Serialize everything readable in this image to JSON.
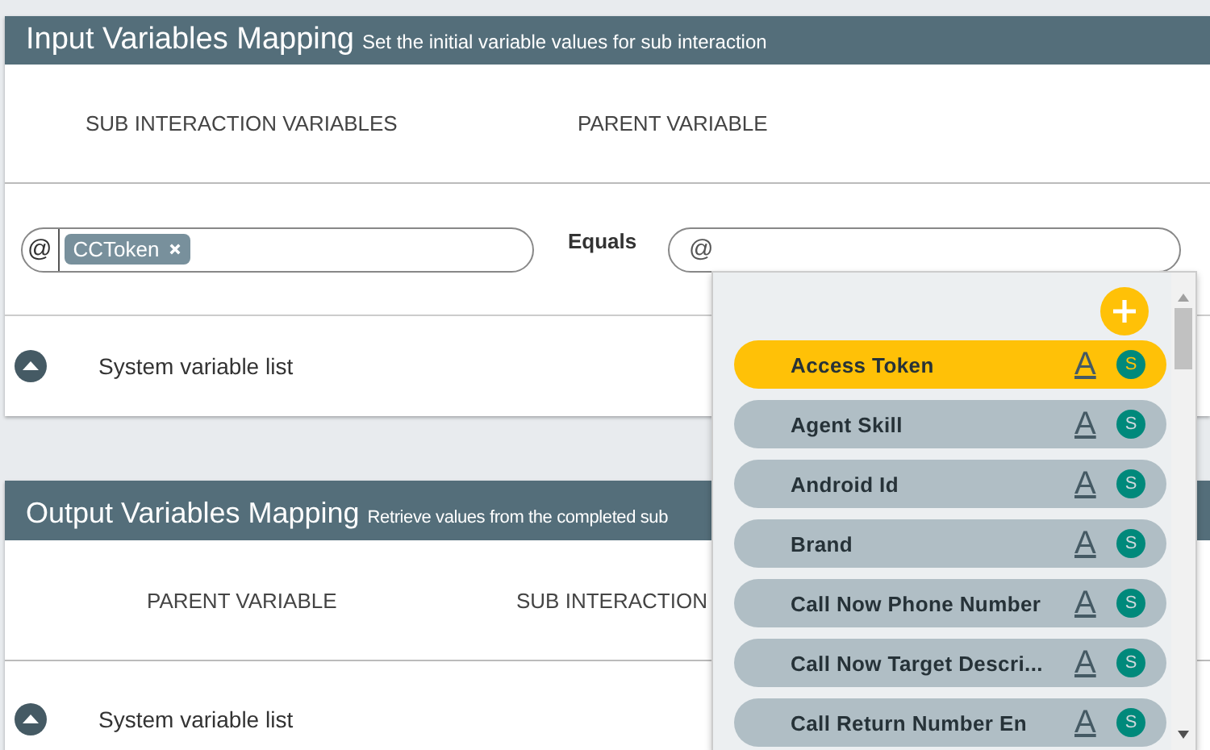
{
  "input_mapping": {
    "title": "Input Variables Mapping",
    "subtitle": "Set the initial variable values for sub interaction",
    "columns": [
      "SUB INTERACTION VARIABLES",
      "PARENT VARIABLE"
    ],
    "source_field": {
      "prefix": "@",
      "tags": [
        {
          "label": "CCToken"
        }
      ]
    },
    "operator": "Equals",
    "target_field": {
      "prefix": "@"
    },
    "system_variable_list": "System variable list"
  },
  "output_mapping": {
    "title": "Output Variables Mapping",
    "subtitle": "Retrieve values from the completed sub",
    "columns": [
      "PARENT VARIABLE",
      "SUB INTERACTION"
    ],
    "system_variable_list": "System variable list"
  },
  "dropdown": {
    "items": [
      {
        "label": "Access Token",
        "type_icon": "A",
        "badge": "S",
        "selected": true
      },
      {
        "label": "Agent Skill",
        "type_icon": "A",
        "badge": "S",
        "selected": false
      },
      {
        "label": "Android Id",
        "type_icon": "A",
        "badge": "S",
        "selected": false
      },
      {
        "label": "Brand",
        "type_icon": "A",
        "badge": "S",
        "selected": false
      },
      {
        "label": "Call Now Phone Number",
        "type_icon": "A",
        "badge": "S",
        "selected": false
      },
      {
        "label": "Call Now Target Descri...",
        "type_icon": "A",
        "badge": "S",
        "selected": false
      },
      {
        "label": "Call Return Number En",
        "type_icon": "A",
        "badge": "S",
        "selected": false
      }
    ]
  }
}
